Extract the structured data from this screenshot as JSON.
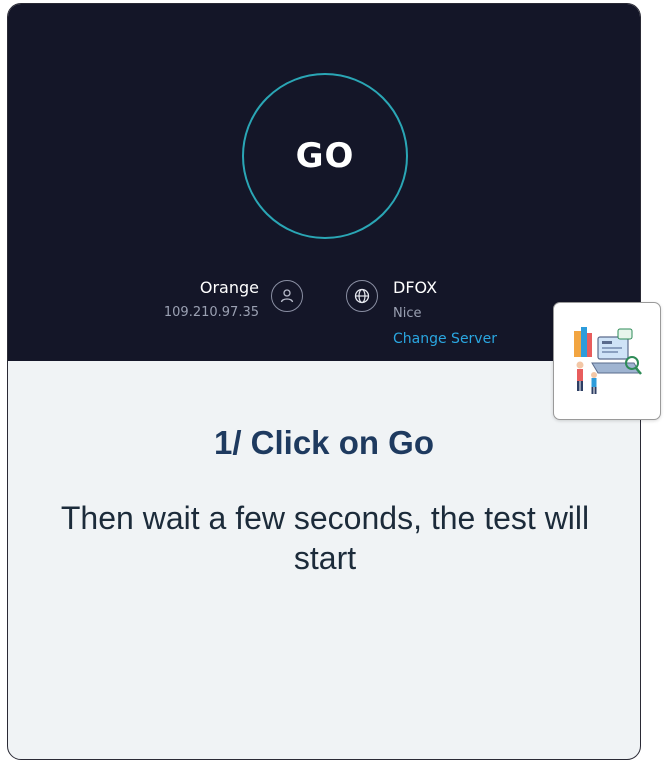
{
  "speedtest": {
    "go_label": "GO",
    "isp": {
      "name": "Orange",
      "ip": "109.210.97.35"
    },
    "server": {
      "name": "DFOX",
      "location": "Nice",
      "change_label": "Change Server"
    }
  },
  "step": {
    "title": "1/ Click on Go",
    "description": "Then wait a few seconds, the test will start"
  },
  "colors": {
    "panel_dark": "#141628",
    "ring_accent": "#2aa6b5",
    "link_blue": "#2aa6e0",
    "title_navy": "#1e3a5f",
    "card_bg": "#f0f3f5"
  },
  "icons": [
    "user-icon",
    "globe-icon",
    "illustration-icon"
  ]
}
